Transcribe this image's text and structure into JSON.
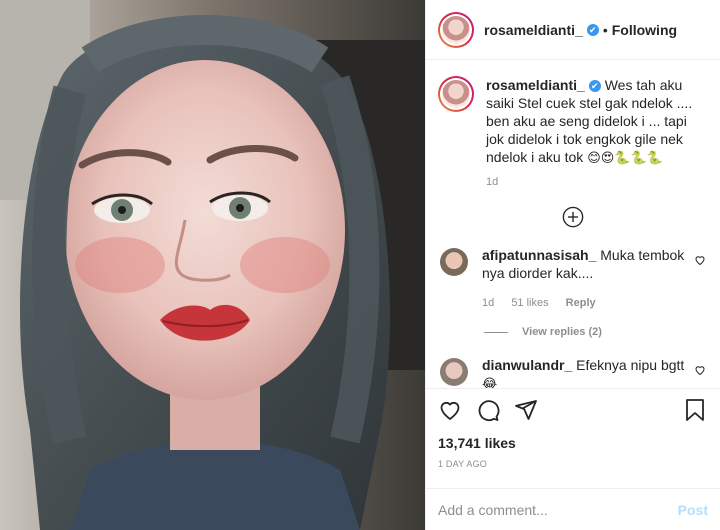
{
  "header": {
    "username": "rosameldianti_",
    "verified_glyph": "✔",
    "separator": "•",
    "follow_status": "Following"
  },
  "caption": {
    "username": "rosameldianti_",
    "verified_glyph": "✔",
    "text": "Wes tah aku saiki Stel cuek stel gak ndelok .... ben aku ae seng didelok i ... tapi jok didelok i tok engkok gile nek ndelok i aku tok",
    "emojis": "😊😍🐍🐍🐍",
    "time": "1d"
  },
  "load_more_icon": "plus-circle-icon",
  "comments": [
    {
      "username": "afipatunnasisah_",
      "text": "Muka tembok nya diorder kak....",
      "time": "1d",
      "likes": "51 likes",
      "reply_label": "Reply",
      "view_replies": "View replies (2)"
    },
    {
      "username": "dianwulandr_",
      "text": "Efeknya nipu bgtt",
      "emoji": "😂"
    }
  ],
  "actions": {
    "like_icon": "heart-icon",
    "comment_icon": "comment-icon",
    "share_icon": "share-icon",
    "save_icon": "bookmark-icon",
    "likes_count": "13,741 likes",
    "posted_ago": "1 DAY AGO"
  },
  "comment_box": {
    "placeholder": "Add a comment...",
    "post_label": "Post"
  },
  "colors": {
    "verified": "#3897f0",
    "post_button_disabled": "#b2dffc",
    "muted_text": "#8e8e8e",
    "border": "#efefef"
  }
}
